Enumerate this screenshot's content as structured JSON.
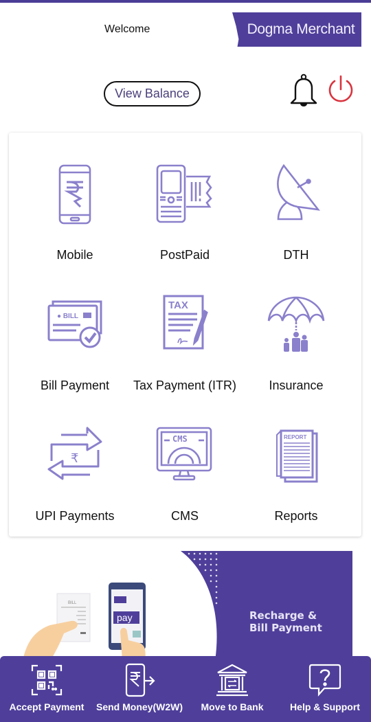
{
  "header": {
    "welcome": "Welcome",
    "brand": "Dogma Merchant",
    "view_balance": "View Balance",
    "notification_icon": "bell-icon",
    "logout_icon": "power-icon"
  },
  "colors": {
    "brand": "#4f3f9a",
    "icon": "#8a80cc",
    "logout": "#d9343f"
  },
  "services": [
    {
      "label": "Mobile",
      "icon": "mobile-recharge-icon"
    },
    {
      "label": "PostPaid",
      "icon": "postpaid-phone-icon"
    },
    {
      "label": "DTH",
      "icon": "satellite-dish-icon"
    },
    {
      "label": "Bill Payment",
      "icon": "bill-check-icon"
    },
    {
      "label": "Tax Payment (ITR)",
      "icon": "tax-document-icon"
    },
    {
      "label": "Insurance",
      "icon": "umbrella-family-icon"
    },
    {
      "label": "UPI Payments",
      "icon": "rupee-transfer-icon"
    },
    {
      "label": "CMS",
      "icon": "cms-monitor-icon"
    },
    {
      "label": "Reports",
      "icon": "report-document-icon"
    }
  ],
  "banner": {
    "line1": "Recharge &",
    "line2": "Bill Payment",
    "bill_text": "BILL",
    "pay_text": "pay"
  },
  "bottom_nav": [
    {
      "label": "Accept Payment",
      "icon": "qr-scan-icon"
    },
    {
      "label": "Send Money(W2W)",
      "icon": "send-money-icon"
    },
    {
      "label": "Move to Bank",
      "icon": "bank-icon"
    },
    {
      "label": "Help & Support",
      "icon": "help-chat-icon"
    }
  ]
}
